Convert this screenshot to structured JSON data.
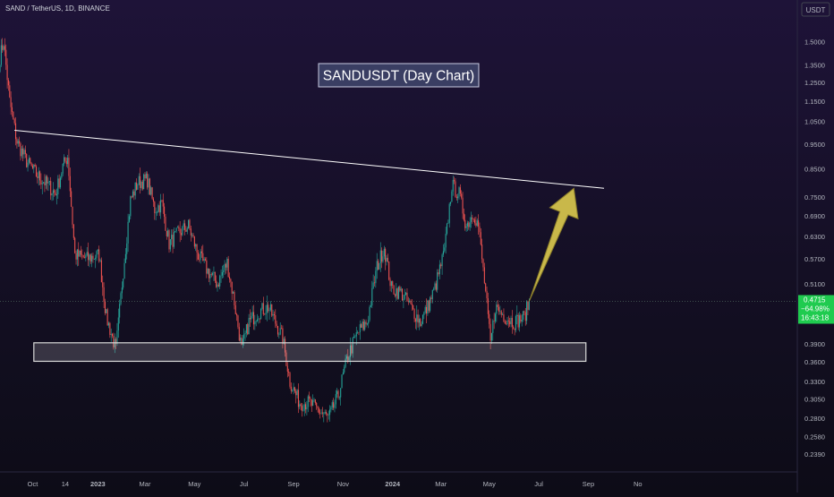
{
  "header": {
    "symbol": "SAND / TetherUS, 1D, BINANCE"
  },
  "annotation_title": "SANDUSDT (Day Chart)",
  "axis_currency": "USDT",
  "price_tag": {
    "price": "0.4715",
    "change": "−64.98%",
    "countdown": "16:43:18"
  },
  "colors": {
    "background_top": "#1e1338",
    "background_bottom": "#0d0c17",
    "candle_up": "#26a69a",
    "candle_down": "#ef5350",
    "trendline": "#ffffff",
    "support_zone_stroke": "#d9d9d9",
    "arrow": "#c9b84a",
    "price_tag": "#1fcb4f",
    "axis_text": "#b2b5be"
  },
  "chart_data": {
    "type": "candlestick",
    "y_scale": "log",
    "y_range": [
      0.225,
      1.72
    ],
    "y_ticks": [
      "1.5000",
      "1.3500",
      "1.2500",
      "1.1500",
      "1.0500",
      "0.9500",
      "0.8500",
      "0.7500",
      "0.6900",
      "0.6300",
      "0.5700",
      "0.5100",
      "0.4500",
      "0.3900",
      "0.3600",
      "0.3300",
      "0.3050",
      "0.2800",
      "0.2580",
      "0.2390"
    ],
    "x_ticks": [
      "Oct",
      "14",
      "2023",
      "Mar",
      "May",
      "Jul",
      "Sep",
      "Nov",
      "2024",
      "Mar",
      "May",
      "Jul",
      "Sep",
      "No"
    ],
    "x_range_days": [
      0,
      660
    ],
    "x_tick_days": [
      27,
      54,
      81,
      120,
      161,
      202,
      243,
      284,
      325,
      365,
      405,
      446,
      487,
      528
    ],
    "last_price": 0.4715,
    "anchors": [
      {
        "day": 0,
        "price": 1.4
      },
      {
        "day": 3,
        "price": 1.5
      },
      {
        "day": 8,
        "price": 1.15
      },
      {
        "day": 14,
        "price": 0.96
      },
      {
        "day": 22,
        "price": 0.88
      },
      {
        "day": 30,
        "price": 0.83
      },
      {
        "day": 40,
        "price": 0.79
      },
      {
        "day": 46,
        "price": 0.76
      },
      {
        "day": 52,
        "price": 0.86
      },
      {
        "day": 56,
        "price": 0.9
      },
      {
        "day": 62,
        "price": 0.58
      },
      {
        "day": 72,
        "price": 0.57
      },
      {
        "day": 82,
        "price": 0.58
      },
      {
        "day": 88,
        "price": 0.44
      },
      {
        "day": 96,
        "price": 0.38
      },
      {
        "day": 102,
        "price": 0.54
      },
      {
        "day": 108,
        "price": 0.74
      },
      {
        "day": 114,
        "price": 0.8
      },
      {
        "day": 122,
        "price": 0.81
      },
      {
        "day": 128,
        "price": 0.71
      },
      {
        "day": 134,
        "price": 0.73
      },
      {
        "day": 140,
        "price": 0.61
      },
      {
        "day": 148,
        "price": 0.64
      },
      {
        "day": 156,
        "price": 0.66
      },
      {
        "day": 164,
        "price": 0.58
      },
      {
        "day": 172,
        "price": 0.54
      },
      {
        "day": 180,
        "price": 0.51
      },
      {
        "day": 188,
        "price": 0.56
      },
      {
        "day": 194,
        "price": 0.47
      },
      {
        "day": 200,
        "price": 0.38
      },
      {
        "day": 206,
        "price": 0.43
      },
      {
        "day": 214,
        "price": 0.45
      },
      {
        "day": 222,
        "price": 0.46
      },
      {
        "day": 228,
        "price": 0.43
      },
      {
        "day": 234,
        "price": 0.4
      },
      {
        "day": 240,
        "price": 0.33
      },
      {
        "day": 248,
        "price": 0.3
      },
      {
        "day": 256,
        "price": 0.3
      },
      {
        "day": 264,
        "price": 0.29
      },
      {
        "day": 272,
        "price": 0.28
      },
      {
        "day": 280,
        "price": 0.31
      },
      {
        "day": 288,
        "price": 0.37
      },
      {
        "day": 296,
        "price": 0.41
      },
      {
        "day": 304,
        "price": 0.43
      },
      {
        "day": 312,
        "price": 0.55
      },
      {
        "day": 318,
        "price": 0.6
      },
      {
        "day": 324,
        "price": 0.5
      },
      {
        "day": 332,
        "price": 0.49
      },
      {
        "day": 340,
        "price": 0.46
      },
      {
        "day": 348,
        "price": 0.43
      },
      {
        "day": 354,
        "price": 0.46
      },
      {
        "day": 360,
        "price": 0.5
      },
      {
        "day": 368,
        "price": 0.59
      },
      {
        "day": 374,
        "price": 0.79
      },
      {
        "day": 380,
        "price": 0.76
      },
      {
        "day": 386,
        "price": 0.66
      },
      {
        "day": 392,
        "price": 0.7
      },
      {
        "day": 396,
        "price": 0.66
      },
      {
        "day": 402,
        "price": 0.49
      },
      {
        "day": 406,
        "price": 0.39
      },
      {
        "day": 410,
        "price": 0.46
      },
      {
        "day": 418,
        "price": 0.44
      },
      {
        "day": 426,
        "price": 0.43
      },
      {
        "day": 434,
        "price": 0.44
      },
      {
        "day": 438,
        "price": 0.4715
      }
    ],
    "trendline": [
      {
        "day": 12,
        "price": 1.01
      },
      {
        "day": 500,
        "price": 0.78
      }
    ],
    "support_zone": {
      "day_start": 28,
      "day_end": 485,
      "price_low": 0.361,
      "price_high": 0.392
    },
    "projection_arrow": {
      "from_day": 438,
      "from_price": 0.4715,
      "to_day": 475,
      "to_price": 0.78
    }
  }
}
